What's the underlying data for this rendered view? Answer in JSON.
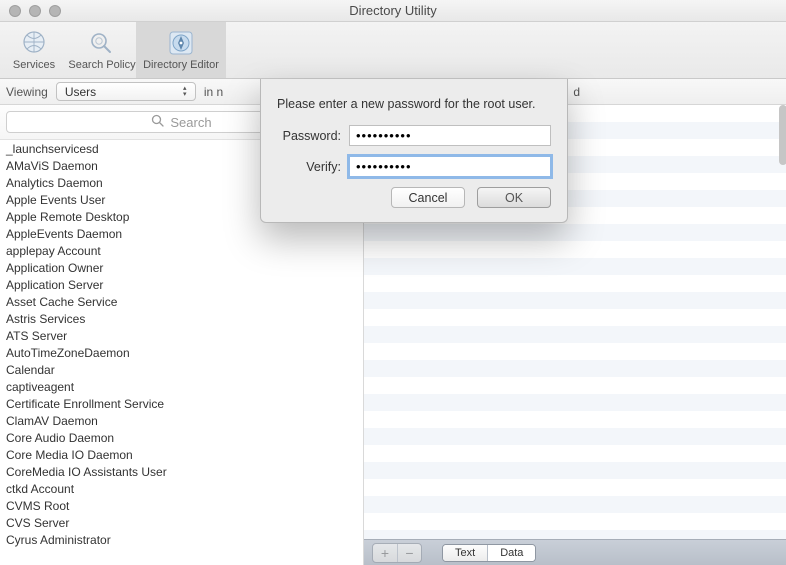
{
  "window": {
    "title": "Directory Utility"
  },
  "toolbar": {
    "items": [
      {
        "label": "Services"
      },
      {
        "label": "Search Policy"
      },
      {
        "label": "Directory Editor"
      }
    ],
    "selected_index": 2
  },
  "viewbar": {
    "viewing_label": "Viewing",
    "popup_value": "Users",
    "trailing": "in n",
    "trailing_far": "d"
  },
  "search": {
    "placeholder": "Search"
  },
  "users": [
    "_launchservicesd",
    "AMaViS Daemon",
    "Analytics Daemon",
    "Apple Events User",
    "Apple Remote Desktop",
    "AppleEvents Daemon",
    "applepay Account",
    "Application Owner",
    "Application Server",
    "Asset Cache Service",
    "Astris Services",
    "ATS Server",
    "AutoTimeZoneDaemon",
    "Calendar",
    "captiveagent",
    "Certificate Enrollment Service",
    "ClamAV Daemon",
    "Core Audio Daemon",
    "Core Media IO Daemon",
    "CoreMedia IO Assistants User",
    "ctkd Account",
    "CVMS Root",
    "CVS Server",
    "Cyrus Administrator"
  ],
  "attr_footer": {
    "seg": {
      "text": "Text",
      "data": "Data",
      "active": "data"
    }
  },
  "sheet": {
    "message": "Please enter a new password for the root user.",
    "password_label": "Password:",
    "verify_label": "Verify:",
    "password_value": "••••••••••",
    "verify_value": "••••••••••",
    "cancel": "Cancel",
    "ok": "OK"
  }
}
